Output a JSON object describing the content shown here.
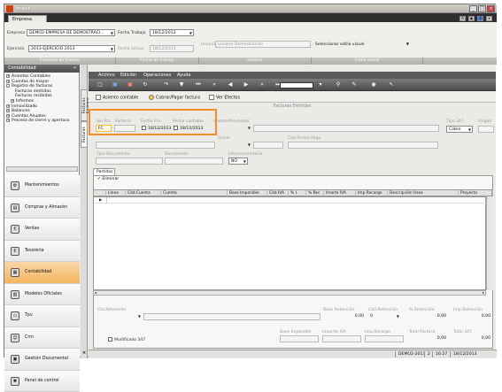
{
  "window": {
    "title": "Indot",
    "buttons": [
      "_",
      "□",
      "×"
    ]
  },
  "tabs": [
    {
      "label": "Empresa"
    }
  ],
  "ribbon": {
    "empresa_label": "Empresa",
    "empresa_value": "DEMO2-EMPRESA DE DEMOSTRACI...",
    "ejercicio_label": "Ejercicio",
    "ejercicio_value": "2013-EJERCICIO 2013",
    "fecha_trabajo_label": "Fecha Trabajo",
    "fecha_trabajo_value": "18/12/2013",
    "fecha_actual_label": "Fecha actual",
    "fecha_actual_value": "18/12/2013",
    "usuario_label": "Usuario",
    "usuario_value": "Usuario Demostración",
    "estilo_value": "Seleccionar estilo visual",
    "group_empresa": "Empresa de trabajo",
    "group_fecha": "Fecha de trabajo",
    "group_usuario": "Usuario",
    "group_estilo": "Estilo visual"
  },
  "sidebar": {
    "title": "Contabilidad",
    "tree": [
      {
        "label": "Asientos Contables",
        "exp": "+",
        "indent": 0
      },
      {
        "label": "Cuentas de mayor",
        "exp": "+",
        "indent": 0
      },
      {
        "label": "Registro de facturas",
        "exp": "-",
        "indent": 0
      },
      {
        "label": "Facturas emitidas",
        "exp": "",
        "indent": 2
      },
      {
        "label": "Facturas recibidas",
        "exp": "",
        "indent": 2
      },
      {
        "label": "Informes",
        "exp": "+",
        "indent": 1
      },
      {
        "label": "Inmovilizado",
        "exp": "+",
        "indent": 0
      },
      {
        "label": "Balances",
        "exp": "+",
        "indent": 0
      },
      {
        "label": "Cuentas Anuales",
        "exp": "+",
        "indent": 0
      },
      {
        "label": "Proceso de cierre y apertura",
        "exp": "+",
        "indent": 0
      }
    ],
    "modules": [
      {
        "label": "Mantenimientos",
        "icon": "wrench-icon",
        "glyph": "⚙"
      },
      {
        "label": "Compras y Almacén",
        "icon": "cart-icon",
        "glyph": "▤"
      },
      {
        "label": "Ventas",
        "icon": "sales-icon",
        "glyph": "€"
      },
      {
        "label": "Tesorería",
        "icon": "treasury-icon",
        "glyph": "€"
      },
      {
        "label": "Contabilidad",
        "icon": "accounting-icon",
        "glyph": "▦",
        "active": true
      },
      {
        "label": "Modelos Oficiales",
        "icon": "forms-icon",
        "glyph": "▥"
      },
      {
        "label": "Tpv",
        "icon": "pos-icon",
        "glyph": "▭"
      },
      {
        "label": "Crm",
        "icon": "crm-icon",
        "glyph": "☺"
      },
      {
        "label": "Gestión Documental",
        "icon": "documents-icon",
        "glyph": "▣"
      },
      {
        "label": "Panel de control",
        "icon": "control-panel-icon",
        "glyph": "✱"
      }
    ]
  },
  "vtabs": {
    "a": "Facturas Emitidas",
    "b": "Facturas"
  },
  "menubar": {
    "items": [
      "Archivo",
      "Edición",
      "Operaciones",
      "Ayuda"
    ]
  },
  "actions": {
    "asiento": "Asiento contable",
    "cobrar": "Cobrar/Pagar factura",
    "efectos": "Ver Efectos"
  },
  "form": {
    "section_title": "Facturas Emitidas",
    "ser_fra_label": "Ser.Fra",
    "ser_fra_value": "FC",
    "factura_label": "Factura",
    "factura_value": "",
    "fecha_fra_label": "Fecha Fra.",
    "fecha_fra_value": "18/12/2013",
    "fecha_contable_label": "Fecha contable",
    "fecha_contable_value": "18/12/2013",
    "cliente_label": "Cliente/Proveedor",
    "tipo347_label": "Tipo 347",
    "tipo347_value": "Cobro",
    "origen_label": "Origen",
    "diario_label": "Diario",
    "forma_pago_label": "Cód.Forma Pago",
    "tipo_doc_label": "Tipo Documento",
    "documento_label": "Documento",
    "intracom_label": "Intracomunitaria",
    "intracom_value": "NO",
    "partidas_tab": "Partidas",
    "eliminar": "Eliminar",
    "columns": [
      "Línea",
      "Cód.Cuenta",
      "Cuenta",
      "Base Imponible",
      "Cód.IVA",
      "% I.",
      "% Rec",
      "Imorte IVA",
      "Imp.Recargo",
      "Descripción línea",
      "Proyecto"
    ],
    "cta_retencion_label": "Cta.Retención",
    "base_ret_label": "Base Retención",
    "base_ret_value": "0,00",
    "cod_ret_label": "Cód.Retención",
    "cod_ret_value": "0",
    "pct_ret_label": "% Retención",
    "pct_ret_value": "0,00",
    "imp_ret_label": "Imp.Retención",
    "imp_ret_value": "0,00",
    "modificado_label": "Modificado 347",
    "base_imp_label": "Base Imponible",
    "importe_iva_label": "Importe IVA",
    "imp_recargo_label": "Imp.Recargo",
    "total_factura_label": "Total Factura",
    "total_factura_value": "0,00",
    "total347_label": "Total 347",
    "total347_value": "0,00"
  },
  "status": {
    "company": "DEMO2-2013",
    "num": "2",
    "time": "16:27",
    "date": "18/12/2013"
  },
  "colors": {
    "highlight": "#f28c28",
    "active_module": "#f3b560"
  }
}
